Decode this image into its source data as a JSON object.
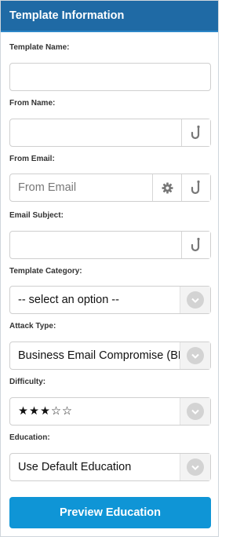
{
  "header": {
    "title": "Template Information"
  },
  "template_name": {
    "label": "Template Name:",
    "value": ""
  },
  "from_name": {
    "label": "From Name:",
    "value": "",
    "addon_icon": "hook-icon"
  },
  "from_email": {
    "label": "From Email:",
    "placeholder": "From Email",
    "addon_icons": [
      "gear-icon",
      "hook-icon"
    ]
  },
  "email_subject": {
    "label": "Email Subject:",
    "value": "",
    "addon_icon": "hook-icon"
  },
  "template_category": {
    "label": "Template Category:",
    "selected": "-- select an option --"
  },
  "attack_type": {
    "label": "Attack Type:",
    "selected": "Business Email Compromise (BEC)"
  },
  "difficulty": {
    "label": "Difficulty:",
    "selected": "★★★☆☆",
    "rating": 3,
    "max": 5
  },
  "education": {
    "label": "Education:",
    "selected": "Use Default Education"
  },
  "preview_button": {
    "label": "Preview Education"
  },
  "colors": {
    "header": "#1f6aa5",
    "button": "#0f95d6"
  }
}
